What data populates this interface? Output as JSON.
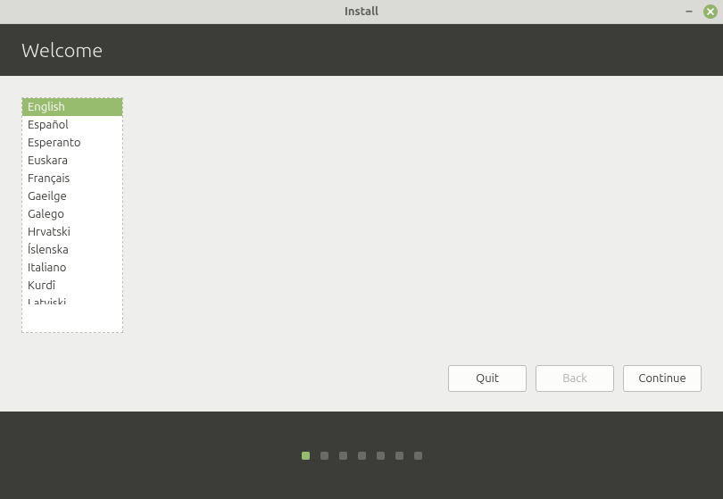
{
  "titlebar": {
    "title": "Install"
  },
  "header": {
    "title": "Welcome"
  },
  "languages": {
    "items": [
      {
        "label": "English",
        "selected": true
      },
      {
        "label": "Español",
        "selected": false
      },
      {
        "label": "Esperanto",
        "selected": false
      },
      {
        "label": "Euskara",
        "selected": false
      },
      {
        "label": "Français",
        "selected": false
      },
      {
        "label": "Gaeilge",
        "selected": false
      },
      {
        "label": "Galego",
        "selected": false
      },
      {
        "label": "Hrvatski",
        "selected": false
      },
      {
        "label": "Íslenska",
        "selected": false
      },
      {
        "label": "Italiano",
        "selected": false
      },
      {
        "label": "Kurdî",
        "selected": false
      },
      {
        "label": "Latviski",
        "selected": false
      }
    ]
  },
  "buttons": {
    "quit": "Quit",
    "back": "Back",
    "continue": "Continue"
  },
  "progress": {
    "total_steps": 7,
    "current_step": 1
  }
}
